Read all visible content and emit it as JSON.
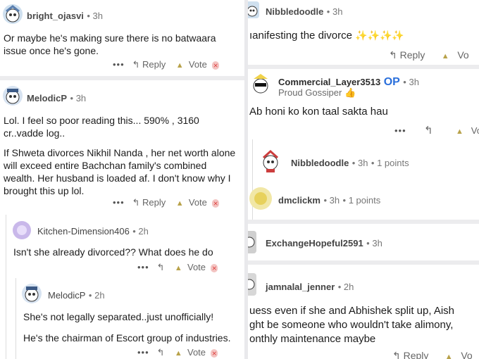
{
  "left": {
    "c1": {
      "user": "bright_ojasvi",
      "time": "3h",
      "text": "Or maybe he's making sure there is no batwaara issue once he's gone.",
      "reply": "Reply",
      "vote": "Vote"
    },
    "c2": {
      "user": "MelodicP",
      "time": "3h",
      "p1": "Lol. I feel so poor reading this... 590% , 3160 cr..vadde log..",
      "p2": "If Shweta divorces Nikhil Nanda , her net worth alone will exceed entire Bachchan family's combined wealth. Her husband is loaded af. I don't know why I brought this up lol.",
      "reply": "Reply",
      "vote": "Vote"
    },
    "c3": {
      "user": "Kitchen-Dimension406",
      "time": "2h",
      "text": "Isn't she already divorced?? What does he do",
      "vote": "Vote"
    },
    "c4": {
      "user": "MelodicP",
      "time": "2h",
      "p1": "She's not legally separated..just unofficially!",
      "p2": "He's the chairman of Escort group of industries.",
      "vote": "Vote"
    }
  },
  "right": {
    "c1": {
      "user": "Nibbledoodle",
      "time": "3h",
      "text": "ıanifesting the divorce",
      "sparkles": "✨✨✨✨",
      "reply": "Reply",
      "vote": "Vo"
    },
    "c2": {
      "user": "Commercial_Layer3513",
      "op": "OP",
      "time": "3h",
      "flair": "Proud Gossiper",
      "flair_emoji": "👍",
      "text": "Ab honi ko kon taal sakta hau",
      "vote": "Vo"
    },
    "c3": {
      "user": "Nibbledoodle",
      "time": "3h",
      "points": "1 points"
    },
    "c4": {
      "user": "dmclickm",
      "time": "3h",
      "points": "1 points"
    },
    "c5": {
      "user": "ExchangeHopeful2591",
      "time": "3h"
    },
    "c6": {
      "user": "jamnalal_jenner",
      "time": "2h",
      "l1": "uess even if she and Abhishek split up, Aish",
      "l2": "ght be someone who wouldn't take alimony,",
      "l3": "onthly maintenance maybe",
      "reply": "Reply",
      "vote": "Vo"
    }
  }
}
